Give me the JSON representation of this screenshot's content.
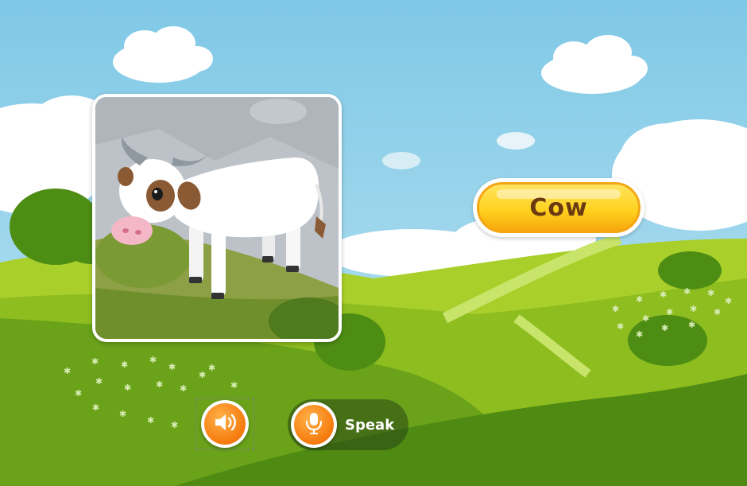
{
  "word": {
    "label": "Cow"
  },
  "picture": {
    "subject": "cow"
  },
  "controls": {
    "play_sound_icon": "speaker-icon",
    "speak": {
      "label": "Speak",
      "icon": "microphone-icon"
    }
  },
  "colors": {
    "sky": "#8ccfe8",
    "grass_light": "#a9cf2b",
    "grass_dark": "#5a9414",
    "button_orange": "#f57a0c",
    "word_yellow": "#ffd21f",
    "word_text": "#6b3a12"
  }
}
